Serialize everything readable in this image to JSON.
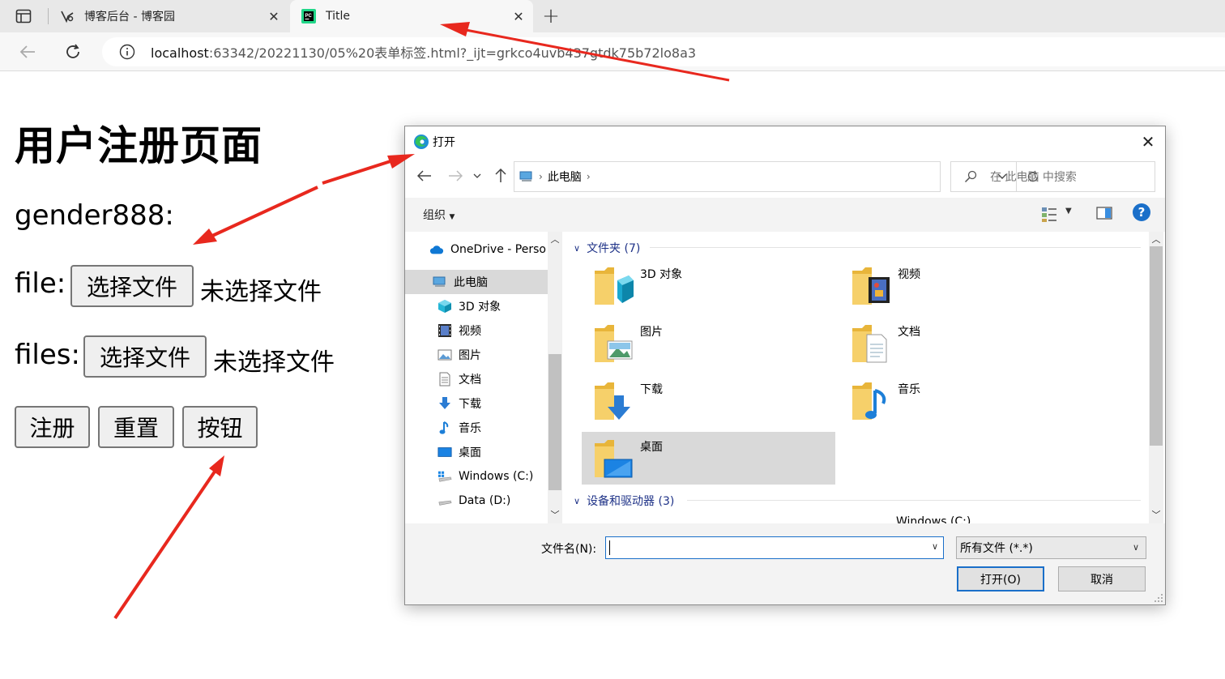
{
  "browser": {
    "tabs": [
      {
        "title": "博客后台 - 博客园",
        "active": false
      },
      {
        "title": "Title",
        "active": true
      }
    ],
    "url_host": "localhost",
    "url_rest": ":63342/20221130/05%20表单标签.html?_ijt=grkco4uvb437gtdk75b72lo8a3"
  },
  "page": {
    "title": "用户注册页面",
    "gender_label": "gender888:",
    "file_label": "file:",
    "files_label": "files:",
    "choose_file": "选择文件",
    "no_file": "未选择文件",
    "buttons": {
      "register": "注册",
      "reset": "重置",
      "button": "按钮"
    }
  },
  "dialog": {
    "title": "打开",
    "path": "此电脑",
    "search_placeholder": "在 此电脑 中搜索",
    "organize": "组织",
    "help": "?",
    "nav": [
      {
        "label": "OneDrive - Perso",
        "icon": "cloud-icon"
      },
      {
        "label": "此电脑",
        "icon": "computer-icon"
      },
      {
        "label": "3D 对象",
        "icon": "cube-icon"
      },
      {
        "label": "视频",
        "icon": "video-icon"
      },
      {
        "label": "图片",
        "icon": "picture-icon"
      },
      {
        "label": "文档",
        "icon": "document-icon"
      },
      {
        "label": "下载",
        "icon": "download-icon"
      },
      {
        "label": "音乐",
        "icon": "music-icon"
      },
      {
        "label": "桌面",
        "icon": "desktop-icon"
      },
      {
        "label": "Windows (C:)",
        "icon": "drive-c-icon"
      },
      {
        "label": "Data (D:)",
        "icon": "drive-d-icon"
      }
    ],
    "folders_header": "文件夹 (7)",
    "folders": [
      {
        "name": "3D 对象",
        "icon": "cube-icon"
      },
      {
        "name": "视频",
        "icon": "video-icon"
      },
      {
        "name": "图片",
        "icon": "picture-icon"
      },
      {
        "name": "文档",
        "icon": "document-icon"
      },
      {
        "name": "下载",
        "icon": "download-icon"
      },
      {
        "name": "音乐",
        "icon": "music-icon"
      },
      {
        "name": "桌面",
        "icon": "desktop-icon"
      }
    ],
    "devices_header": "设备和驱动器 (3)",
    "partial_device": "Windows (C:)",
    "filename_label": "文件名(N):",
    "filename_value": "",
    "filetype": "所有文件 (*.*)",
    "open": "打开(O)",
    "cancel": "取消"
  },
  "colors": {
    "accent": "#1a6fc9",
    "annotation_arrow": "#e8281e",
    "folder_yellow": "#f3c74f"
  }
}
